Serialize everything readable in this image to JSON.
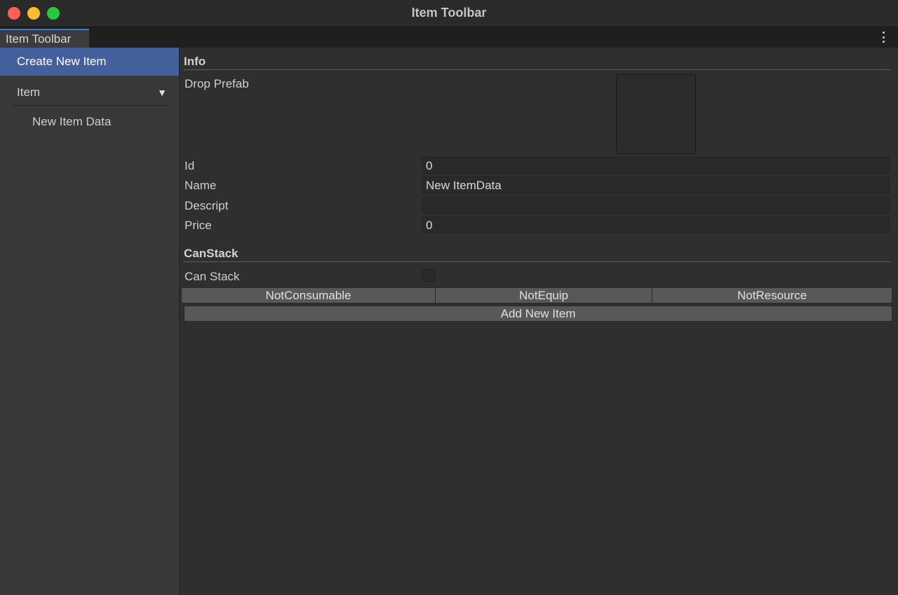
{
  "window": {
    "title": "Item Toolbar",
    "tab_label": "Item Toolbar",
    "menu_icon": "kebab-menu-icon"
  },
  "sidebar": {
    "create_label": "Create New Item",
    "group_label": "Item",
    "group_arrow": "▼",
    "child_label": "New Item Data",
    "colors": {
      "selected": "#44609c"
    }
  },
  "info": {
    "section_title": "Info",
    "drop_prefab_label": "Drop Prefab",
    "fields": [
      {
        "label": "Id",
        "value": "0"
      },
      {
        "label": "Name",
        "value": "New ItemData"
      },
      {
        "label": "Descript",
        "value": ""
      },
      {
        "label": "Price",
        "value": "0"
      }
    ]
  },
  "canstack": {
    "section_title": "CanStack",
    "can_stack_label": "Can Stack",
    "checked": false
  },
  "type_buttons": [
    "NotConsumable",
    "NotEquip",
    "NotResource"
  ],
  "add_button_label": "Add New Item"
}
